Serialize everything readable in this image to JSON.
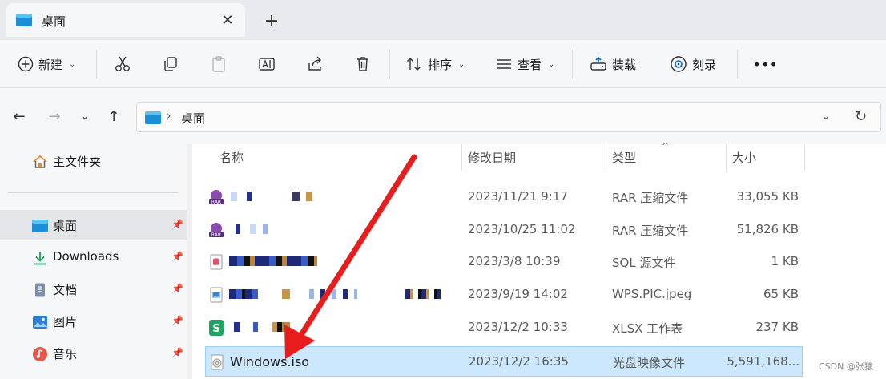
{
  "tab": {
    "label": "桌面",
    "close": "✕",
    "new": "+"
  },
  "toolbar": {
    "new_label": "新建",
    "sort_label": "排序",
    "view_label": "查看",
    "mount_label": "装载",
    "burn_label": "刻录",
    "more": "•••"
  },
  "address": {
    "crumb": "桌面"
  },
  "sidebar": {
    "items": [
      {
        "label": "主文件夹"
      },
      {
        "label": "桌面"
      },
      {
        "label": "Downloads"
      },
      {
        "label": "文档"
      },
      {
        "label": "图片"
      },
      {
        "label": "音乐"
      }
    ]
  },
  "columns": {
    "name": "名称",
    "date": "修改日期",
    "type": "类型",
    "size": "大小"
  },
  "rows": [
    {
      "date": "2023/11/21 9:17",
      "type": "RAR 压缩文件",
      "size": "33,055 KB"
    },
    {
      "date": "2023/10/25 11:02",
      "type": "RAR 压缩文件",
      "size": "51,826 KB"
    },
    {
      "date": "2023/3/8 10:39",
      "type": "SQL 源文件",
      "size": "1 KB"
    },
    {
      "date": "2023/9/19 14:02",
      "type": "WPS.PIC.jpeg",
      "size": "65 KB"
    },
    {
      "date": "2023/12/2 10:33",
      "type": "XLSX 工作表",
      "size": "237 KB"
    },
    {
      "name": "Windows.iso",
      "date": "2023/12/2 16:35",
      "type": "光盘映像文件",
      "size": "5,591,168..."
    }
  ],
  "icons": {
    "rar": "rar-icon",
    "sql": "sql-file-icon",
    "image": "image-file-icon",
    "xlsx": "xlsx-icon",
    "iso": "disc-image-icon"
  },
  "colors": {
    "accent": "#0067c0",
    "selection": "#cce8ff",
    "arrow": "#e81e1e",
    "folder": "#2ea6e6"
  },
  "watermark": "CSDN @张猿"
}
